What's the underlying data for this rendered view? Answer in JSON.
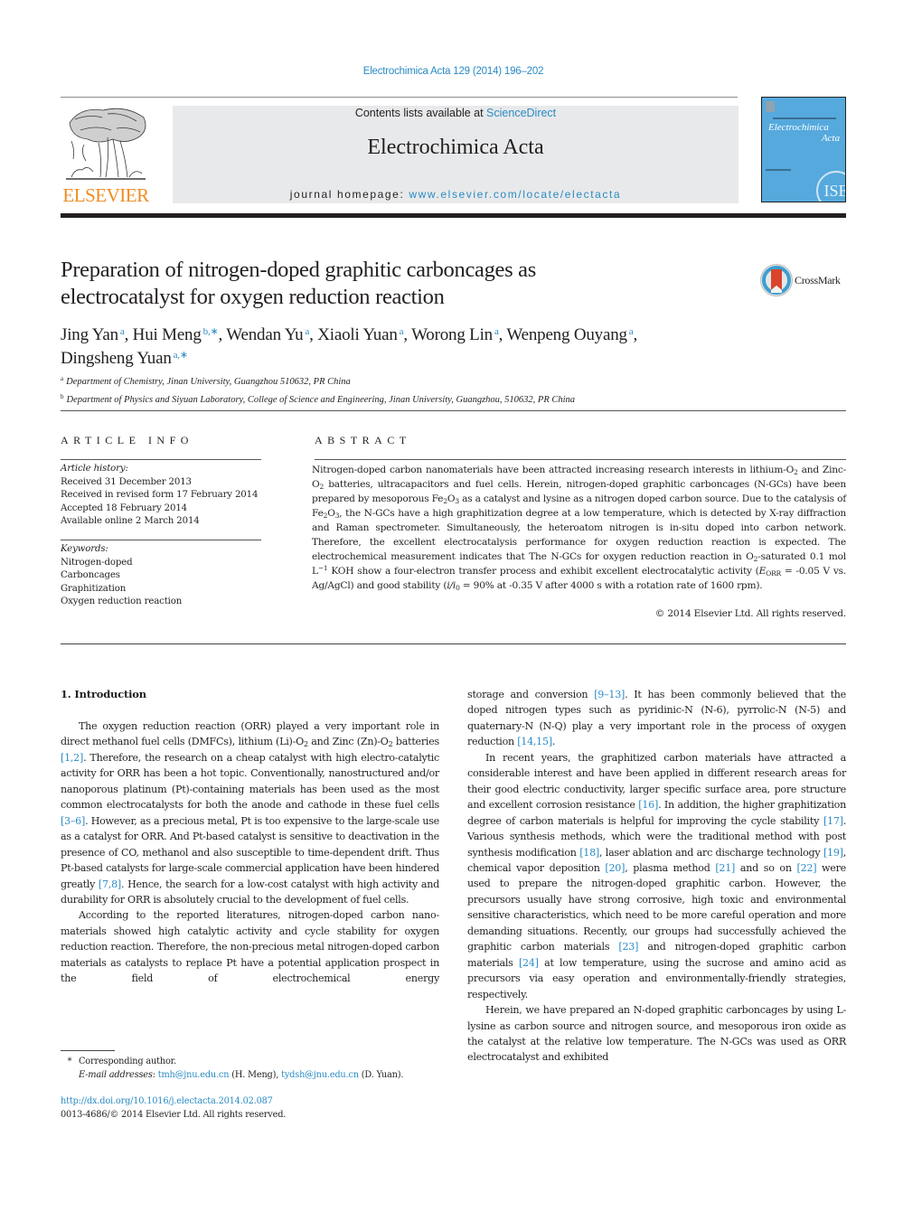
{
  "header": {
    "citation": "Electrochimica Acta 129 (2014) 196–202",
    "publisher_logo_text": "ELSEVIER",
    "contents_prefix": "Contents lists available at ",
    "contents_link": "ScienceDirect",
    "journal_name": "Electrochimica Acta",
    "homepage_prefix": "journal homepage: ",
    "homepage_link": "www.elsevier.com/locate/electacta",
    "cover": {
      "title_line1": "Electrochimica",
      "title_line2": "Acta",
      "badge": "ISE",
      "background_color": "#55a9dd"
    },
    "accent_color": "#2a8bc4",
    "publisher_color": "#f08c23"
  },
  "article": {
    "title_line1": "Preparation of nitrogen-doped graphitic carboncages as",
    "title_line2": "electrocatalyst for oxygen reduction reaction",
    "crossmark_label": "CrossMark",
    "authors": [
      {
        "name": "Jing Yan",
        "aff": "a",
        "sep": ", "
      },
      {
        "name": "Hui Meng",
        "aff": "b,∗",
        "sep": ", "
      },
      {
        "name": "Wendan Yu",
        "aff": "a",
        "sep": ", "
      },
      {
        "name": "Xiaoli Yuan",
        "aff": "a",
        "sep": ", "
      },
      {
        "name": "Worong Lin",
        "aff": "a",
        "sep": ", "
      },
      {
        "name": "Wenpeng Ouyang",
        "aff": "a",
        "sep": ","
      },
      {
        "name": "Dingsheng Yuan",
        "aff": "a,∗",
        "sep": ""
      }
    ],
    "affiliations": [
      {
        "mark": "a",
        "text": "Department of Chemistry, Jinan University, Guangzhou 510632, PR China"
      },
      {
        "mark": "b",
        "text": "Department of Physics and Siyuan Laboratory, College of Science and Engineering, Jinan University, Guangzhou, 510632, PR China"
      }
    ]
  },
  "article_info": {
    "heading": "ARTICLE INFO",
    "history_label": "Article history:",
    "history": [
      "Received 31 December 2013",
      "Received in revised form 17 February 2014",
      "Accepted 18 February 2014",
      "Available online 2 March 2014"
    ],
    "keywords_label": "Keywords:",
    "keywords": [
      "Nitrogen-doped",
      "Carboncages",
      "Graphitization",
      "Oxygen reduction reaction"
    ]
  },
  "abstract": {
    "heading": "ABSTRACT",
    "s1": "Nitrogen-doped carbon nanomaterials have been attracted increasing research interests in lithium-O",
    "s2": " and Zinc-O",
    "s3": " batteries, ultracapacitors and fuel cells. Herein, nitrogen-doped graphitic carboncages (N-GCs) have been prepared by mesoporous Fe",
    "s4": "O",
    "s5": " as a catalyst and lysine as a nitrogen doped carbon source. Due to the catalysis of Fe",
    "s6": "O",
    "s7": ", the N-GCs have a high graphitization degree at a low temperature, which is detected by X-ray diffraction and Raman spectrometer. Simultaneously, the heteroatom nitrogen is in-situ doped into carbon network. Therefore, the excellent electrocatalysis performance for oxygen reduction reaction is expected. The electrochemical measurement indicates that The N-GCs for oxygen reduction reaction in O",
    "s8": "-saturated 0.1 mol L",
    "s9": " KOH show a four-electron transfer process and exhibit excellent electrocatalytic activity (",
    "e_sym": "E",
    "e_sub": "ORR",
    "s10": " = -0.05 V vs. Ag/AgCl) and good stability (",
    "ratio": "i/i",
    "ratio_sub": "0",
    "s11": " = 90% at -0.35 V after 4000 s with a rotation rate of 1600 rpm).",
    "sub2": "2",
    "sub3": "3",
    "sup_neg1": "−1",
    "copyright": "© 2014 Elsevier Ltd. All rights reserved."
  },
  "intro": {
    "heading": "1.  Introduction",
    "p1": {
      "a": "The oxygen reduction reaction (ORR) played a very important role in direct methanol fuel cells (DMFCs), lithium (Li)-O",
      "b": " and Zinc (Zn)-O",
      "c": " batteries ",
      "ref1": "[1,2]",
      "d": ". Therefore, the research on a cheap catalyst with high electro-catalytic activity for ORR has been a hot topic. Conventionally, nanostructured and/or nanoporous platinum (Pt)-containing materials has been used as the most common electrocatalysts for both the anode and cathode in these fuel cells ",
      "ref2": "[3–6]",
      "e": ". However, as a precious metal, Pt is too expensive to the large-scale use as a catalyst for ORR. And Pt-based catalyst is sensitive to deactivation in the presence of CO, methanol and also susceptible to time-dependent drift. Thus Pt-based catalysts for large-scale commercial application have been hindered greatly ",
      "ref3": "[7,8]",
      "f": ". Hence, the search for a low-cost catalyst with high activity and durability for ORR is absolutely crucial to the development of fuel cells."
    },
    "p2": {
      "a": "According to the reported literatures, nitrogen-doped carbon nano-materials showed high catalytic activity and cycle stability for oxygen reduction reaction. Therefore, the non-precious metal nitrogen-doped carbon materials as catalysts to replace Pt have a potential application prospect in the field of electrochemical energy storage and conversion ",
      "ref1": "[9–13]",
      "b": ". It has been commonly believed that the doped nitrogen types such as pyridinic-N (N-6), pyrrolic-N (N-5) and quaternary-N (N-Q) play a very important role in the process of oxygen reduction ",
      "ref2": "[14,15]",
      "c": "."
    },
    "p3": {
      "a": "In recent years, the graphitized carbon materials have attracted a considerable interest and have been applied in different research areas for their good electric conductivity, larger specific surface area, pore structure and excellent corrosion resistance ",
      "ref1": "[16]",
      "b": ". In addition, the higher graphitization degree of carbon materials is helpful for improving the cycle stability ",
      "ref2": "[17]",
      "c": ". Various synthesis methods, which were the traditional method with post synthesis modification ",
      "ref3": "[18]",
      "d": ", laser ablation and arc discharge technology ",
      "ref4": "[19]",
      "e": ", chemical vapor deposition ",
      "ref5": "[20]",
      "f": ", plasma method ",
      "ref6": "[21]",
      "g": " and so on ",
      "ref7": "[22]",
      "h": " were used to prepare the nitrogen-doped graphitic carbon. However, the precursors usually have strong corrosive, high toxic and environmental sensitive characteristics, which need to be more careful operation and more demanding situations. Recently, our groups had successfully achieved the graphitic carbon materials ",
      "ref8": "[23]",
      "i": " and nitrogen-doped graphitic carbon materials ",
      "ref9": "[24]",
      "j": " at low temperature, using the sucrose and amino acid as precursors via easy operation and environmentally-friendly strategies, respectively."
    },
    "p4": {
      "a": "Herein, we have prepared an N-doped graphitic carboncages by using L-lysine as carbon source and nitrogen source, and mesoporous iron oxide as the catalyst at the relative low temperature. The N-GCs was used as ORR electrocatalyst and exhibited"
    },
    "sub2": "2"
  },
  "footnotes": {
    "star": "*",
    "corresponding": "Corresponding author.",
    "email_label": "E-mail addresses: ",
    "email1": "tmh@jnu.edu.cn",
    "email1_owner": " (H. Meng), ",
    "email2": "tydsh@jnu.edu.cn",
    "email2_owner": " (D. Yuan).",
    "doi": "http://dx.doi.org/10.1016/j.electacta.2014.02.087",
    "issn_line": "0013-4686/© 2014 Elsevier Ltd. All rights reserved."
  }
}
